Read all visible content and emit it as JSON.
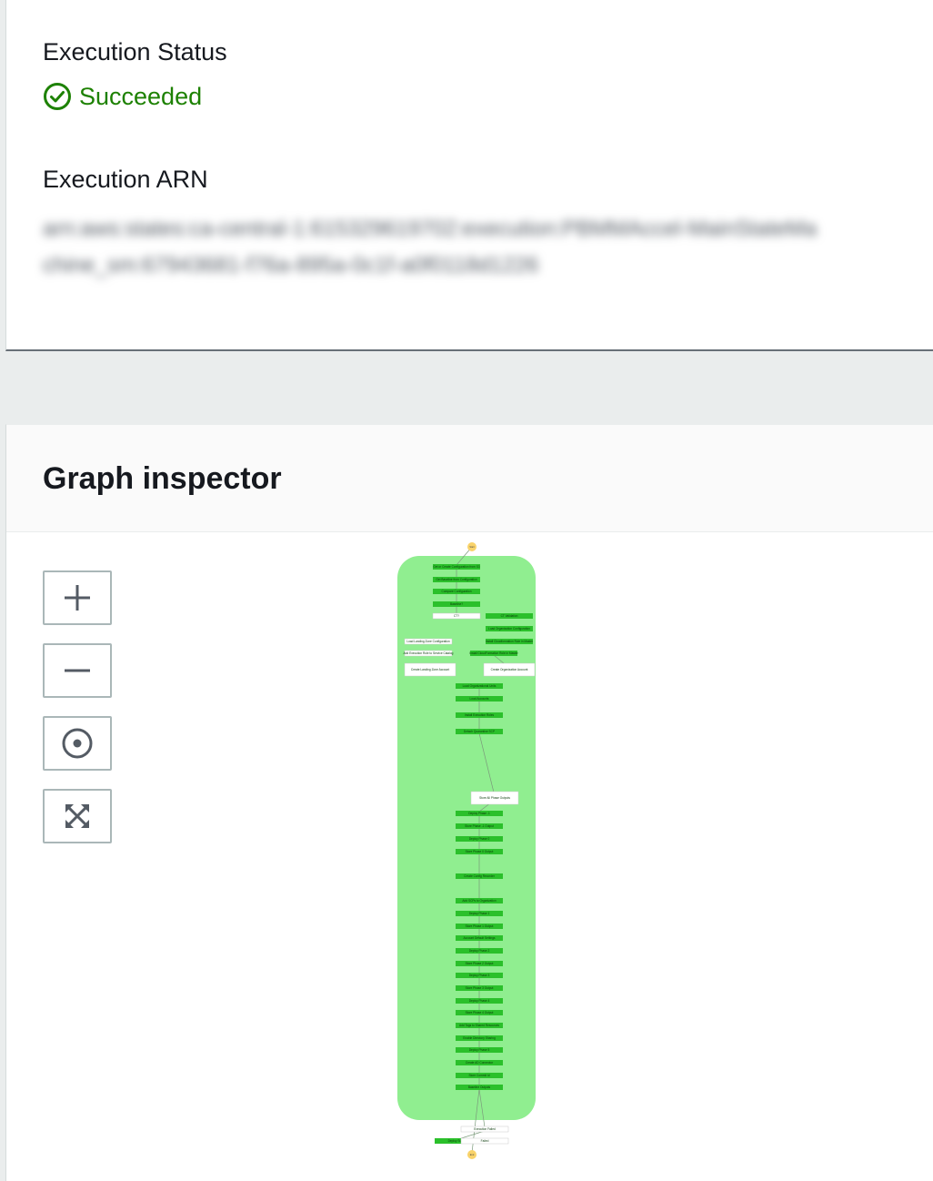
{
  "execution": {
    "status_label": "Execution Status",
    "status_value": "Succeeded",
    "status_color": "#1d8102",
    "status_icon": "check-circle-icon",
    "arn_label": "Execution ARN",
    "arn_value": "arn:aws:states:ca-central-1:615329619702:execution:PBMMAccel-MainStateMachine_sm:67943681-f76a-895a-0c1f-a0f0118d1226"
  },
  "graph_inspector": {
    "title": "Graph inspector",
    "controls": [
      {
        "name": "zoom-in",
        "icon": "plus-icon"
      },
      {
        "name": "zoom-out",
        "icon": "minus-icon"
      },
      {
        "name": "center",
        "icon": "target-icon"
      },
      {
        "name": "fit",
        "icon": "expand-icon"
      }
    ],
    "group_color": "#90ee90",
    "node_color": "#2bc02b",
    "start_label": "Start",
    "end_label": "End",
    "nodes": [
      "Get or Create Configuration from S3",
      "Get Baseline from Configuration",
      "Compare Configuration",
      "Baseline?",
      "CT?",
      "CT Validation",
      "Load Landing Zone Configuration",
      "Load Organization Configuration",
      "Add Execution Role to Service Catalog",
      "Install Cloudformation Role in Master",
      "Create Landing Zone Account",
      "Install CloudFormation Role in Master",
      "Create Organization Account",
      "Load Organizational Units",
      "Load Accounts",
      "Install Execution Roles",
      "Detach Quarantine SCP",
      "Store All Phase Outputs",
      "Deploy Phase -1",
      "Store Phase -1 Output",
      "Deploy Phase 0",
      "Store Phase 0 Output",
      "Create Config Recorder",
      "Add SCPs to Organization",
      "Deploy Phase 1",
      "Store Phase 1 Output",
      "Account Default Settings",
      "Deploy Phase 2",
      "Store Phase 2 Output",
      "Deploy Phase 3",
      "Store Phase 3 Output",
      "Deploy Phase 4",
      "Store Phase 4 Output",
      "Add Tags to Shared Resources",
      "Enable Directory Sharing",
      "Deploy Phase 5",
      "Create AD Connector",
      "Store Commit Id",
      "Baseline Outputs",
      "Execution Failed",
      "Deploy Success",
      "Failed"
    ]
  }
}
